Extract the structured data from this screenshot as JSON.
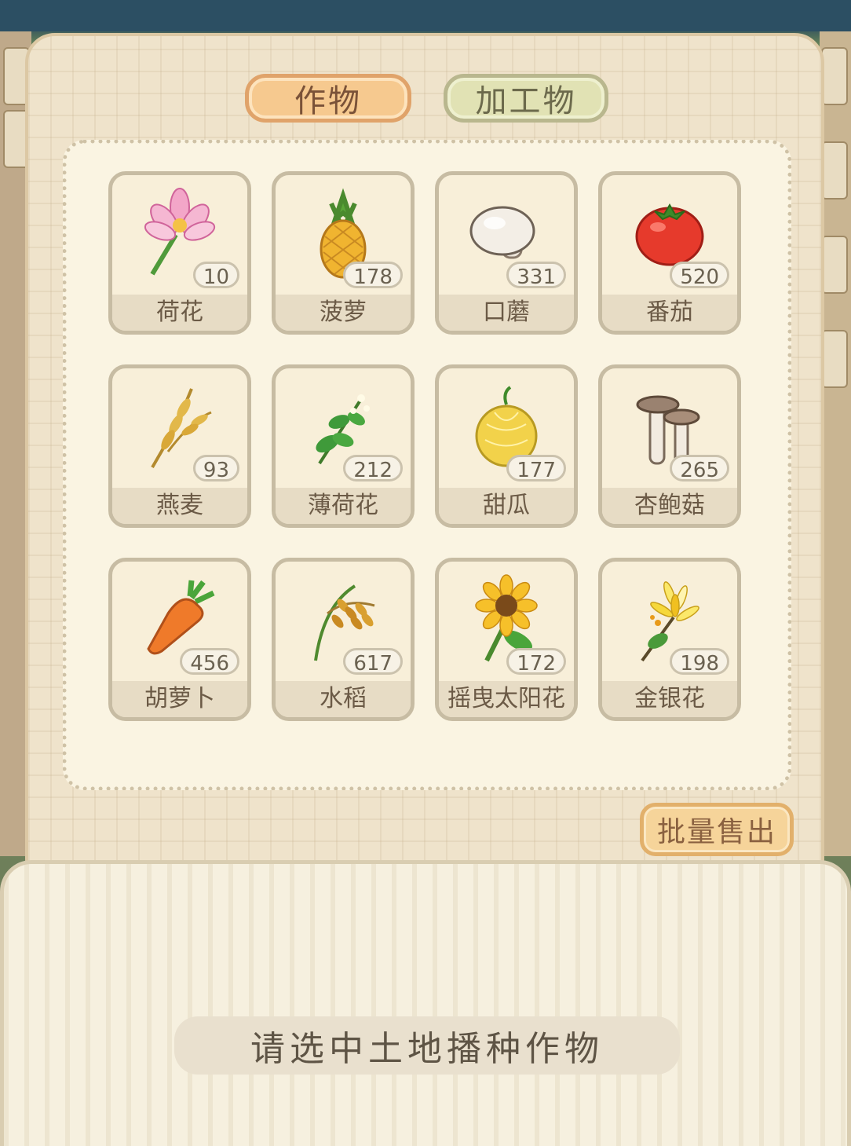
{
  "tabs": [
    {
      "label": "作物",
      "active": true
    },
    {
      "label": "加工物",
      "active": false
    }
  ],
  "items": [
    {
      "name": "荷花",
      "count": "10",
      "icon": "lotus-icon"
    },
    {
      "name": "菠萝",
      "count": "178",
      "icon": "pineapple-icon"
    },
    {
      "name": "口蘑",
      "count": "331",
      "icon": "mushroom-icon"
    },
    {
      "name": "番茄",
      "count": "520",
      "icon": "tomato-icon"
    },
    {
      "name": "燕麦",
      "count": "93",
      "icon": "oat-icon"
    },
    {
      "name": "薄荷花",
      "count": "212",
      "icon": "mint-flower-icon"
    },
    {
      "name": "甜瓜",
      "count": "177",
      "icon": "melon-icon"
    },
    {
      "name": "杏鲍菇",
      "count": "265",
      "icon": "king-oyster-mushroom-icon"
    },
    {
      "name": "胡萝卜",
      "count": "456",
      "icon": "carrot-icon"
    },
    {
      "name": "水稻",
      "count": "617",
      "icon": "rice-icon"
    },
    {
      "name": "摇曳太阳花",
      "count": "172",
      "icon": "sunflower-icon"
    },
    {
      "name": "金银花",
      "count": "198",
      "icon": "honeysuckle-icon"
    }
  ],
  "sell_button": "批量售出",
  "hint": "请选中土地播种作物",
  "colors": {
    "panel": "#efe3cb",
    "tab_active": "#f6c98f",
    "tab_inactive": "#e1e2b4",
    "sell_button": "#f6d49a"
  }
}
